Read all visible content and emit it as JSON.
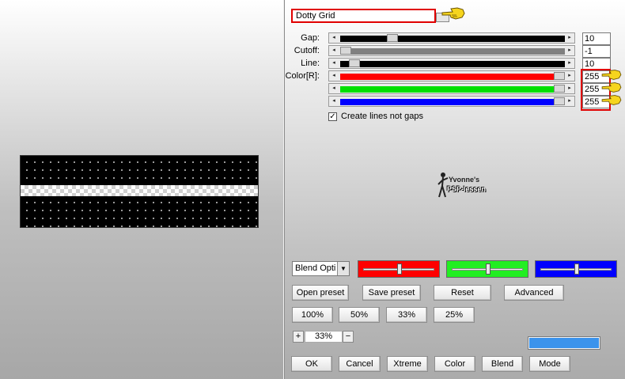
{
  "preset_name": "Dotty Grid",
  "sliders": [
    {
      "label": "Gap:",
      "value": "10",
      "fill_color": "#000000",
      "level": 0.22
    },
    {
      "label": "Cutoff:",
      "value": "-1",
      "fill_color": "#808080",
      "level": 0.0
    },
    {
      "label": "Line:",
      "value": "10",
      "fill_color": "#000000",
      "level": 0.04
    },
    {
      "label": "Color[R]:",
      "value": "255",
      "fill_color": "#ff0000",
      "level": 1.0
    },
    {
      "label": "",
      "value": "255",
      "fill_color": "#00e000",
      "level": 1.0
    },
    {
      "label": "",
      "value": "255",
      "fill_color": "#0000ff",
      "level": 1.0
    }
  ],
  "checkbox": {
    "label": "Create lines not gaps",
    "checked_glyph": "✓"
  },
  "watermark": {
    "line1": "Yvonne's",
    "line2": "PSP-lessen"
  },
  "blend_select": {
    "value": "Blend Opti",
    "arrow": "▼"
  },
  "color_sliders": [
    {
      "color": "#ff0000",
      "level": 0.5
    },
    {
      "color": "#22ee22",
      "level": 0.5
    },
    {
      "color": "#0000ff",
      "level": 0.5
    }
  ],
  "preset_buttons": [
    "Open preset",
    "Save preset",
    "Reset",
    "Advanced"
  ],
  "zoom_buttons": [
    "100%",
    "50%",
    "33%",
    "25%"
  ],
  "zoom": {
    "plus": "+",
    "value": "33%",
    "minus": "−"
  },
  "bottom_buttons": [
    "OK",
    "Cancel",
    "Xtreme",
    "Color",
    "Blend",
    "Mode"
  ],
  "arrows": {
    "left": "◂",
    "right": "▸"
  },
  "accent_blue": "#3b93ec",
  "highlight_red": "#e00000"
}
